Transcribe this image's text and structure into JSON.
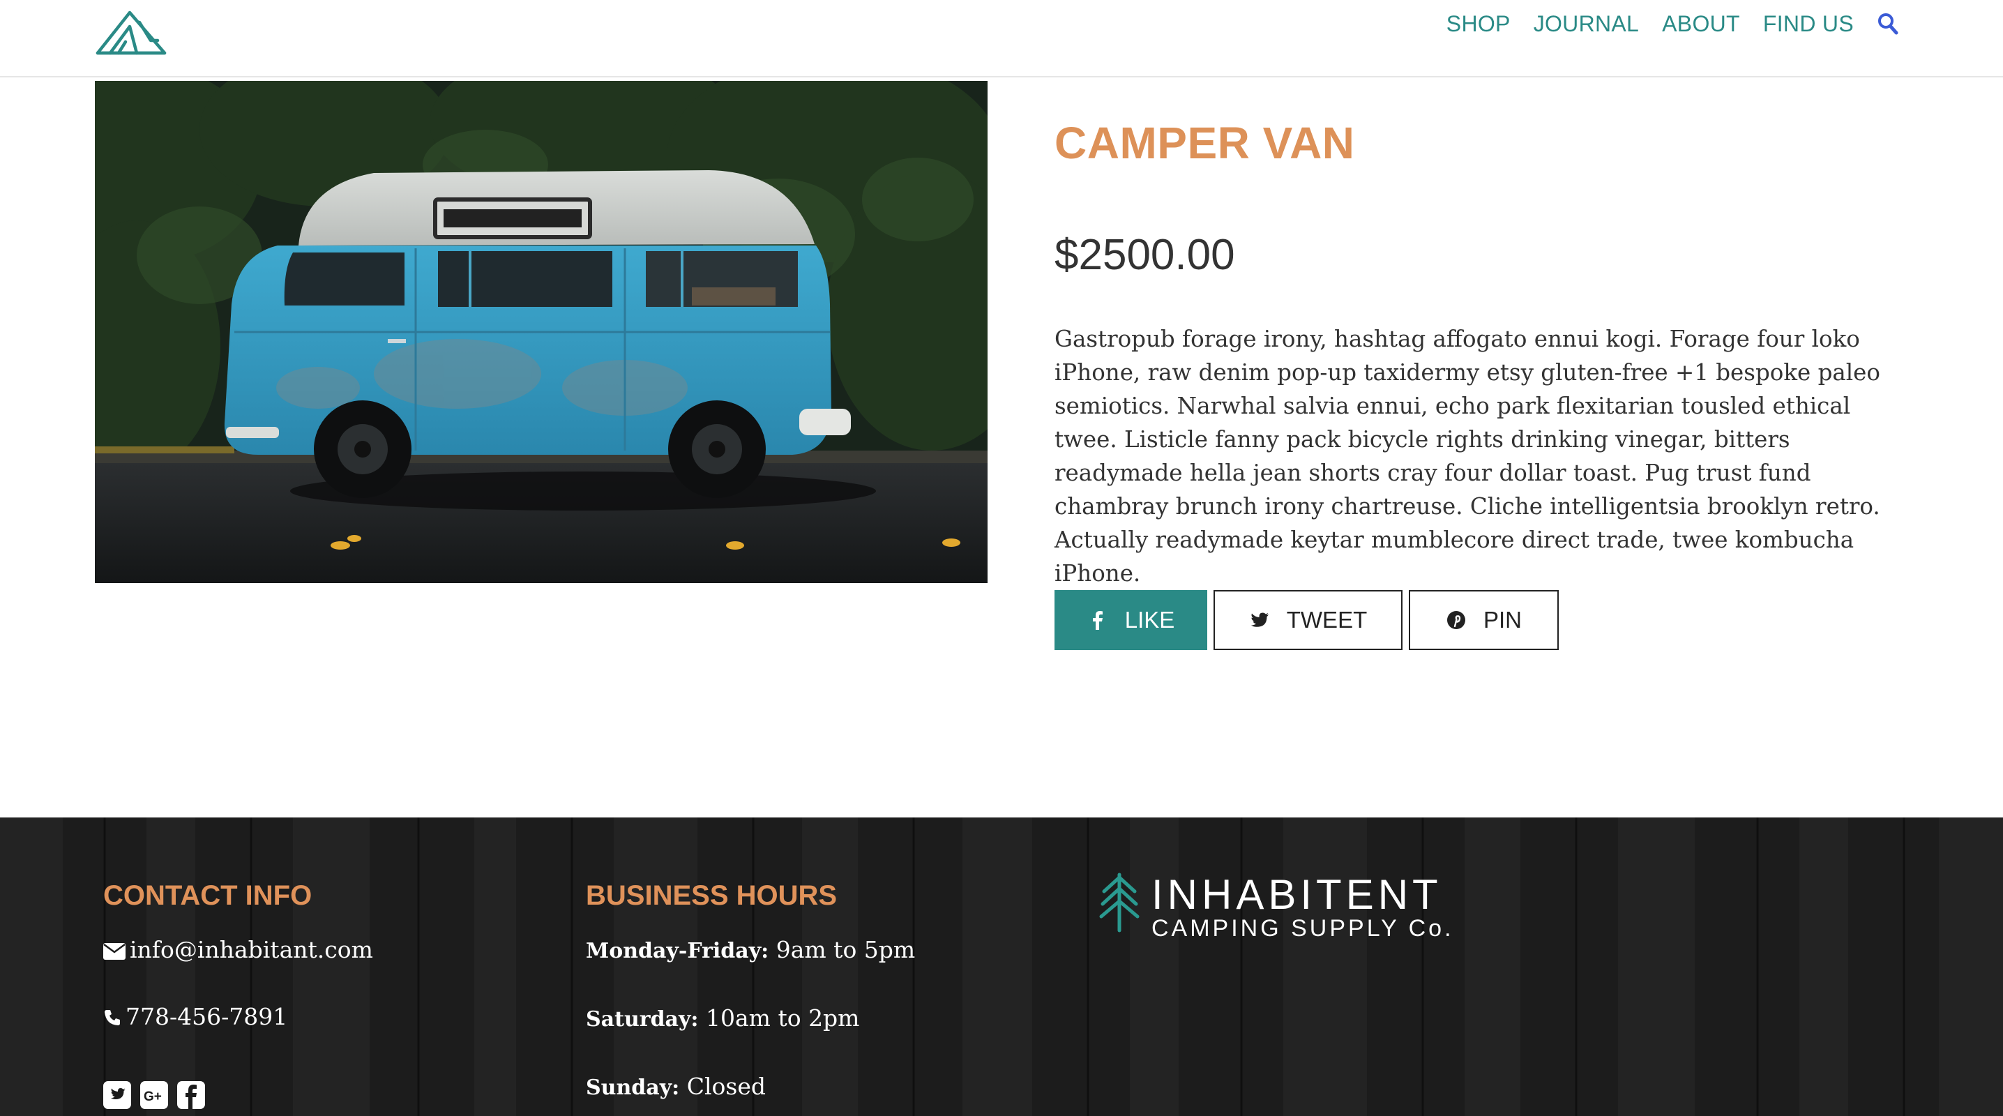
{
  "header": {
    "logo_alt": "tent-logo",
    "nav": [
      {
        "label": "SHOP"
      },
      {
        "label": "JOURNAL"
      },
      {
        "label": "ABOUT"
      },
      {
        "label": "FIND US"
      }
    ],
    "search_icon": "search-icon"
  },
  "product": {
    "title": "CAMPER VAN",
    "price": "$2500.00",
    "description": "Gastropub forage irony, hashtag affogato ennui kogi. Forage four loko iPhone, raw denim pop-up taxidermy etsy gluten-free +1 bespoke paleo semiotics. Narwhal salvia ennui, echo park flexitarian tousled ethical twee. Listicle fanny pack bicycle rights drinking vinegar, bitters readymade hella jean shorts cray four dollar toast. Pug trust fund chambray brunch irony chartreuse. Cliche intelligentsia brooklyn retro. Actually readymade keytar mumblecore direct trade, twee kombucha iPhone.",
    "share": {
      "like": "LIKE",
      "tweet": "TWEET",
      "pin": "PIN"
    }
  },
  "footer": {
    "contact": {
      "heading": "CONTACT INFO",
      "email": "info@inhabitant.com",
      "phone": "778-456-7891"
    },
    "hours": {
      "heading": "BUSINESS HOURS",
      "rows": [
        {
          "day": "Monday-Friday:",
          "time": "9am to 5pm"
        },
        {
          "day": "Saturday:",
          "time": "10am to 2pm"
        },
        {
          "day": "Sunday:",
          "time": "Closed"
        }
      ]
    },
    "brand": {
      "name": "INHABITENT",
      "sub": "CAMPING SUPPLY Co."
    }
  },
  "colors": {
    "accent": "#2a8a86",
    "orange": "#dd9158",
    "text": "#333333",
    "footer_bg": "#1b1b1b"
  }
}
